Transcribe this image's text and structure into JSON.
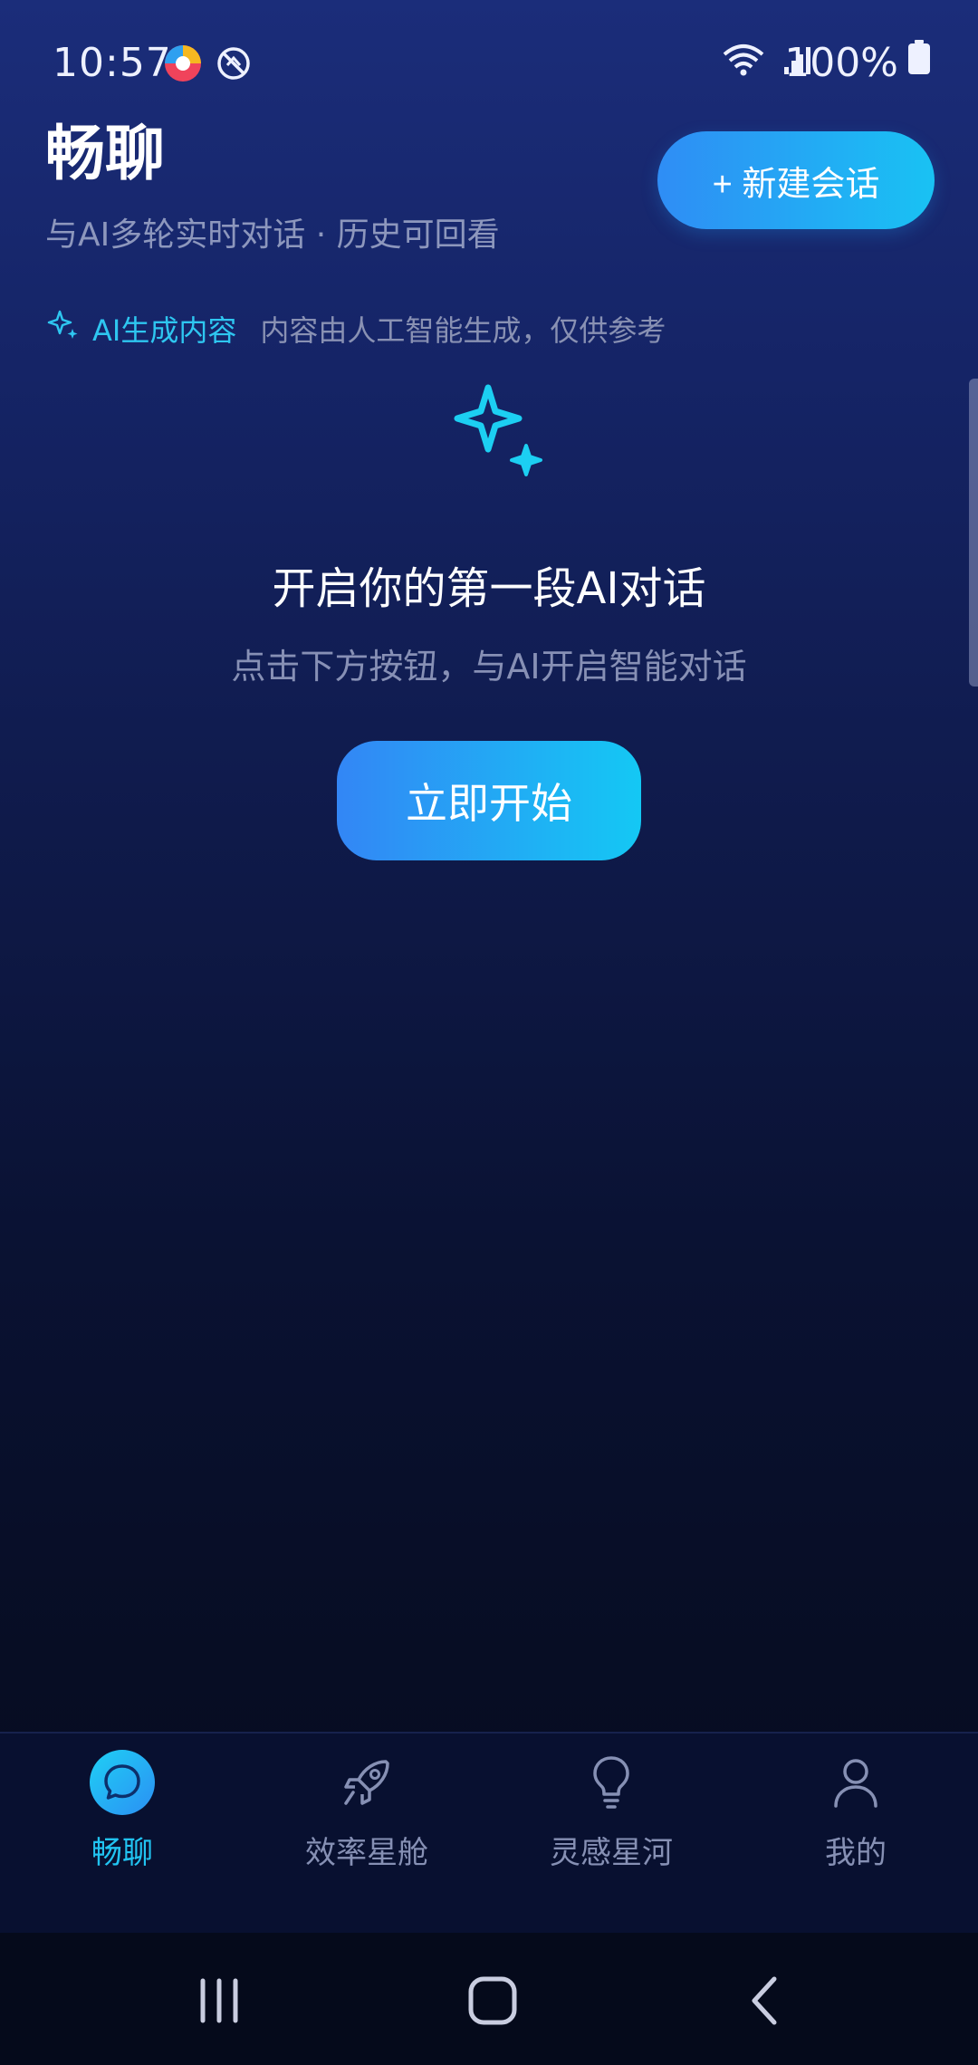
{
  "status_bar": {
    "time": "10:57",
    "battery": "100%"
  },
  "header": {
    "title": "畅聊",
    "subtitle": "与AI多轮实时对话 · 历史可回看",
    "new_chat_label": "+ 新建会话"
  },
  "ai_notice": {
    "label": "AI生成内容",
    "description": "内容由人工智能生成，仅供参考"
  },
  "empty_state": {
    "title": "开启你的第一段AI对话",
    "description": "点击下方按钮，与AI开启智能对话",
    "start_label": "立即开始"
  },
  "bottom_nav": {
    "items": [
      {
        "label": "畅聊",
        "icon": "chat-bubble-icon",
        "active": true
      },
      {
        "label": "效率星舱",
        "icon": "rocket-icon",
        "active": false
      },
      {
        "label": "灵感星河",
        "icon": "lightbulb-icon",
        "active": false
      },
      {
        "label": "我的",
        "icon": "user-icon",
        "active": false
      }
    ]
  },
  "colors": {
    "accent": "#21c4f2",
    "gradient_start": "#2f8df5",
    "gradient_end": "#19c2f3",
    "muted_text": "#8690b4"
  }
}
